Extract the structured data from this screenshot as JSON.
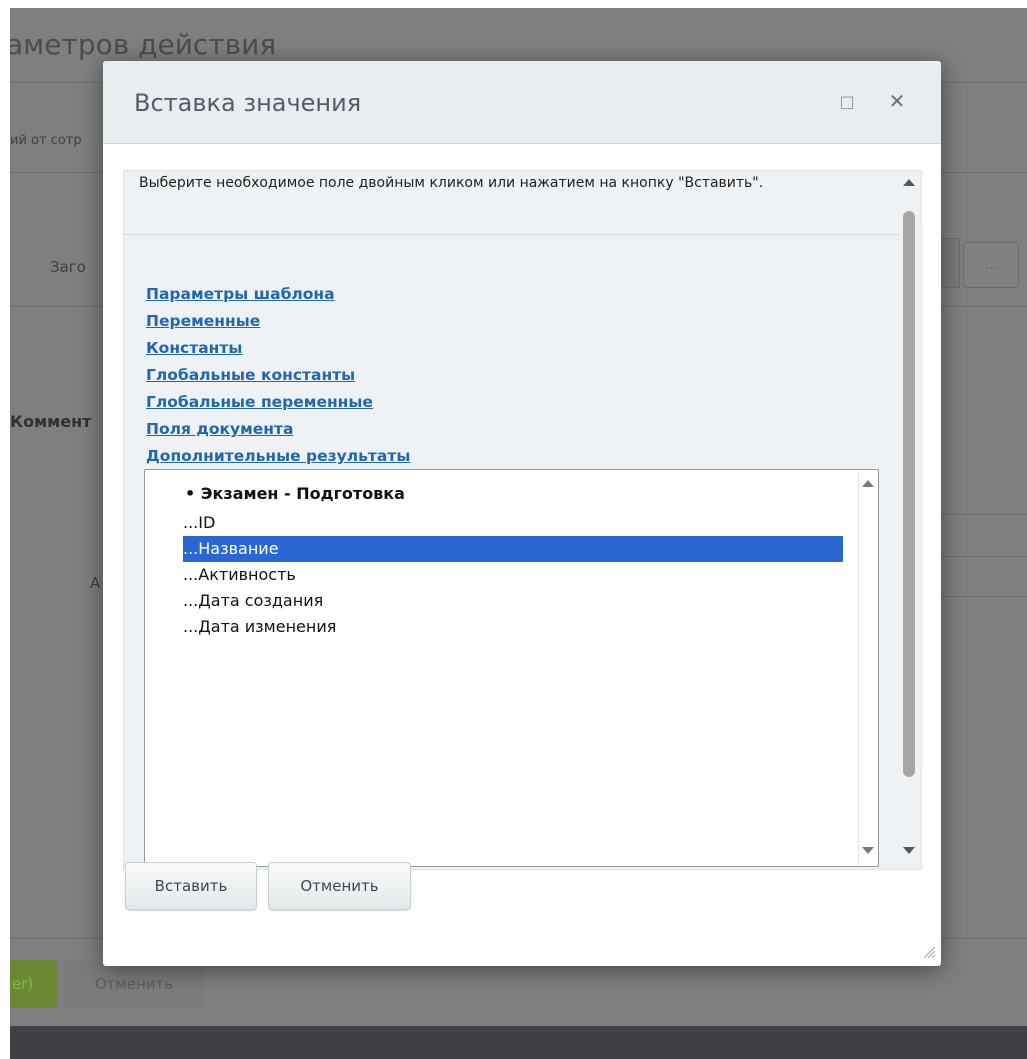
{
  "background": {
    "title": "аметров действия",
    "subtitle": "ий от сотр",
    "labels": [
      "Заго",
      "Коммент",
      "А"
    ],
    "small_button": "...",
    "primary_button": "er)",
    "cancel_button": "Отменить"
  },
  "dialog": {
    "title": "Вставка значения",
    "maximize_icon": "□",
    "close_icon": "✕",
    "instruction": "Выберите необходимое поле двойным кликом или нажатием на кнопку \"Вставить\".",
    "links": [
      "Параметры шаблона",
      "Переменные",
      "Константы",
      "Глобальные константы",
      "Глобальные переменные",
      "Поля документа",
      "Дополнительные результаты"
    ],
    "list": {
      "group_header": "• Экзамен - Подготовка",
      "items": [
        "...ID",
        "...Название",
        "...Активность",
        "...Дата создания",
        "...Дата изменения"
      ],
      "selected_index": 1
    },
    "buttons": {
      "insert": "Вставить",
      "cancel": "Отменить"
    },
    "colors": {
      "selection": "#2a67d2",
      "link": "#2067b0",
      "header_bg": "#e9edef"
    }
  }
}
